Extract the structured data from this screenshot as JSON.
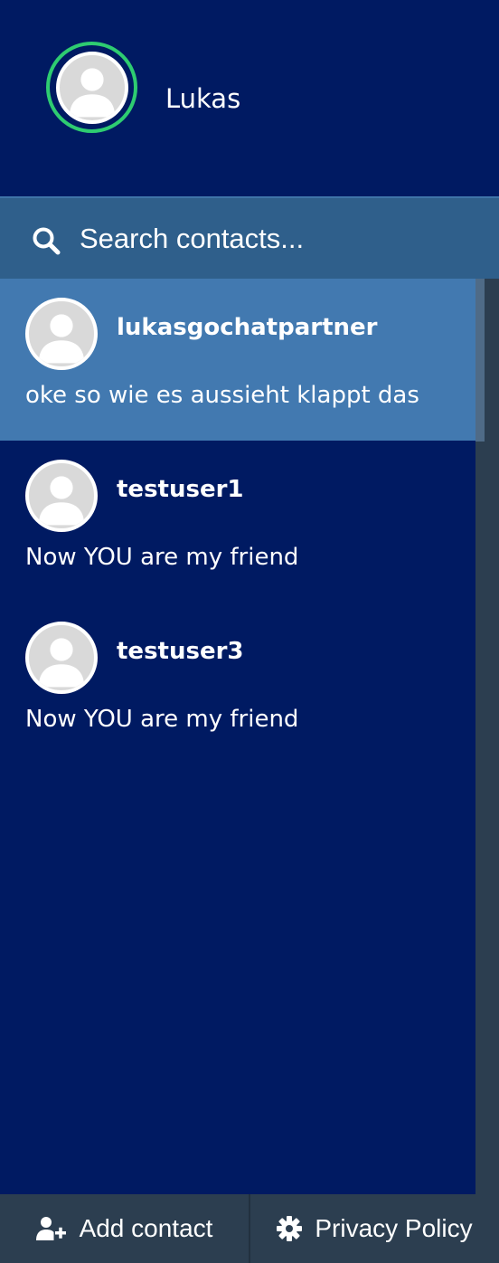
{
  "profile": {
    "name": "Lukas",
    "status_color": "#2ecc71",
    "avatar_icon": "user-silhouette-icon"
  },
  "search": {
    "placeholder": "Search contacts...",
    "icon": "search-icon"
  },
  "contacts": [
    {
      "name": "lukasgochatpartner",
      "preview": "oke so wie es aussieht klappt das",
      "active": true
    },
    {
      "name": "testuser1",
      "preview": "Now YOU are my friend",
      "active": false
    },
    {
      "name": "testuser3",
      "preview": "Now YOU are my friend",
      "active": false
    }
  ],
  "footer": {
    "add_contact_label": "Add contact",
    "add_contact_icon": "user-plus-icon",
    "privacy_label": "Privacy Policy",
    "privacy_icon": "gear-icon"
  },
  "colors": {
    "background": "#001a62",
    "search_bar": "#2f5f8b",
    "active_contact": "#4279b0",
    "footer": "#2c3e50"
  }
}
